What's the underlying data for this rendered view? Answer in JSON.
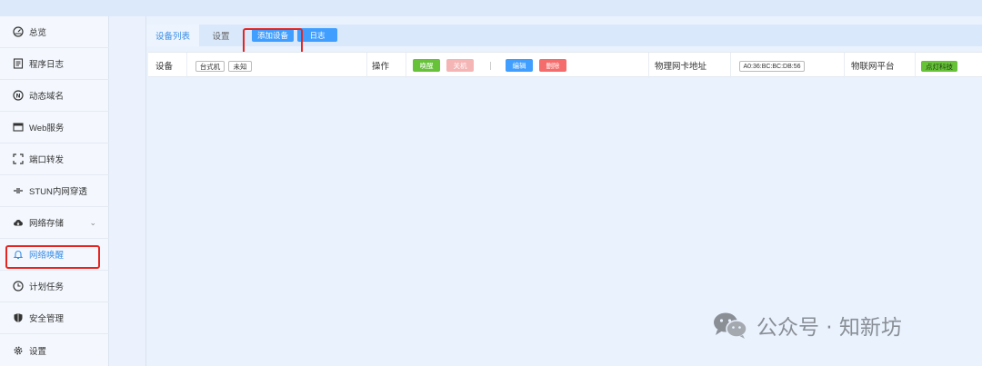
{
  "sidebar": {
    "items": [
      {
        "label": "总览",
        "icon": "dashboard-icon"
      },
      {
        "label": "程序日志",
        "icon": "log-icon"
      },
      {
        "label": "动态域名",
        "icon": "ddns-icon"
      },
      {
        "label": "Web服务",
        "icon": "web-icon"
      },
      {
        "label": "端口转发",
        "icon": "port-forward-icon"
      },
      {
        "label": "STUN内网穿透",
        "icon": "stun-icon"
      },
      {
        "label": "网络存储",
        "icon": "cloud-icon"
      },
      {
        "label": "网络唤醒",
        "icon": "bell-icon"
      },
      {
        "label": "计划任务",
        "icon": "clock-icon"
      },
      {
        "label": "安全管理",
        "icon": "shield-icon"
      },
      {
        "label": "设置",
        "icon": "gear-icon"
      }
    ]
  },
  "tabs": {
    "device_list": "设备列表",
    "settings": "设置",
    "add_device": "添加设备",
    "log": "日志"
  },
  "table": {
    "device_header": "设备",
    "device_tags": [
      "台式机",
      "未知"
    ],
    "operation_header": "操作",
    "wake_btn": "唤醒",
    "shutdown_btn": "关机",
    "edit_btn": "编辑",
    "delete_btn": "删除",
    "mac_header": "物理网卡地址",
    "mac_value": "A0:36:BC:BC:DB:56",
    "iot_header": "物联网平台",
    "iot_value": "点灯科技"
  },
  "watermark": {
    "text": "公众号 · 知新坊"
  },
  "colors": {
    "accent": "#409eff",
    "wake": "#67c23a",
    "shutdown": "#f5b5b5",
    "delete": "#f56c6c",
    "highlight": "#e52520"
  }
}
